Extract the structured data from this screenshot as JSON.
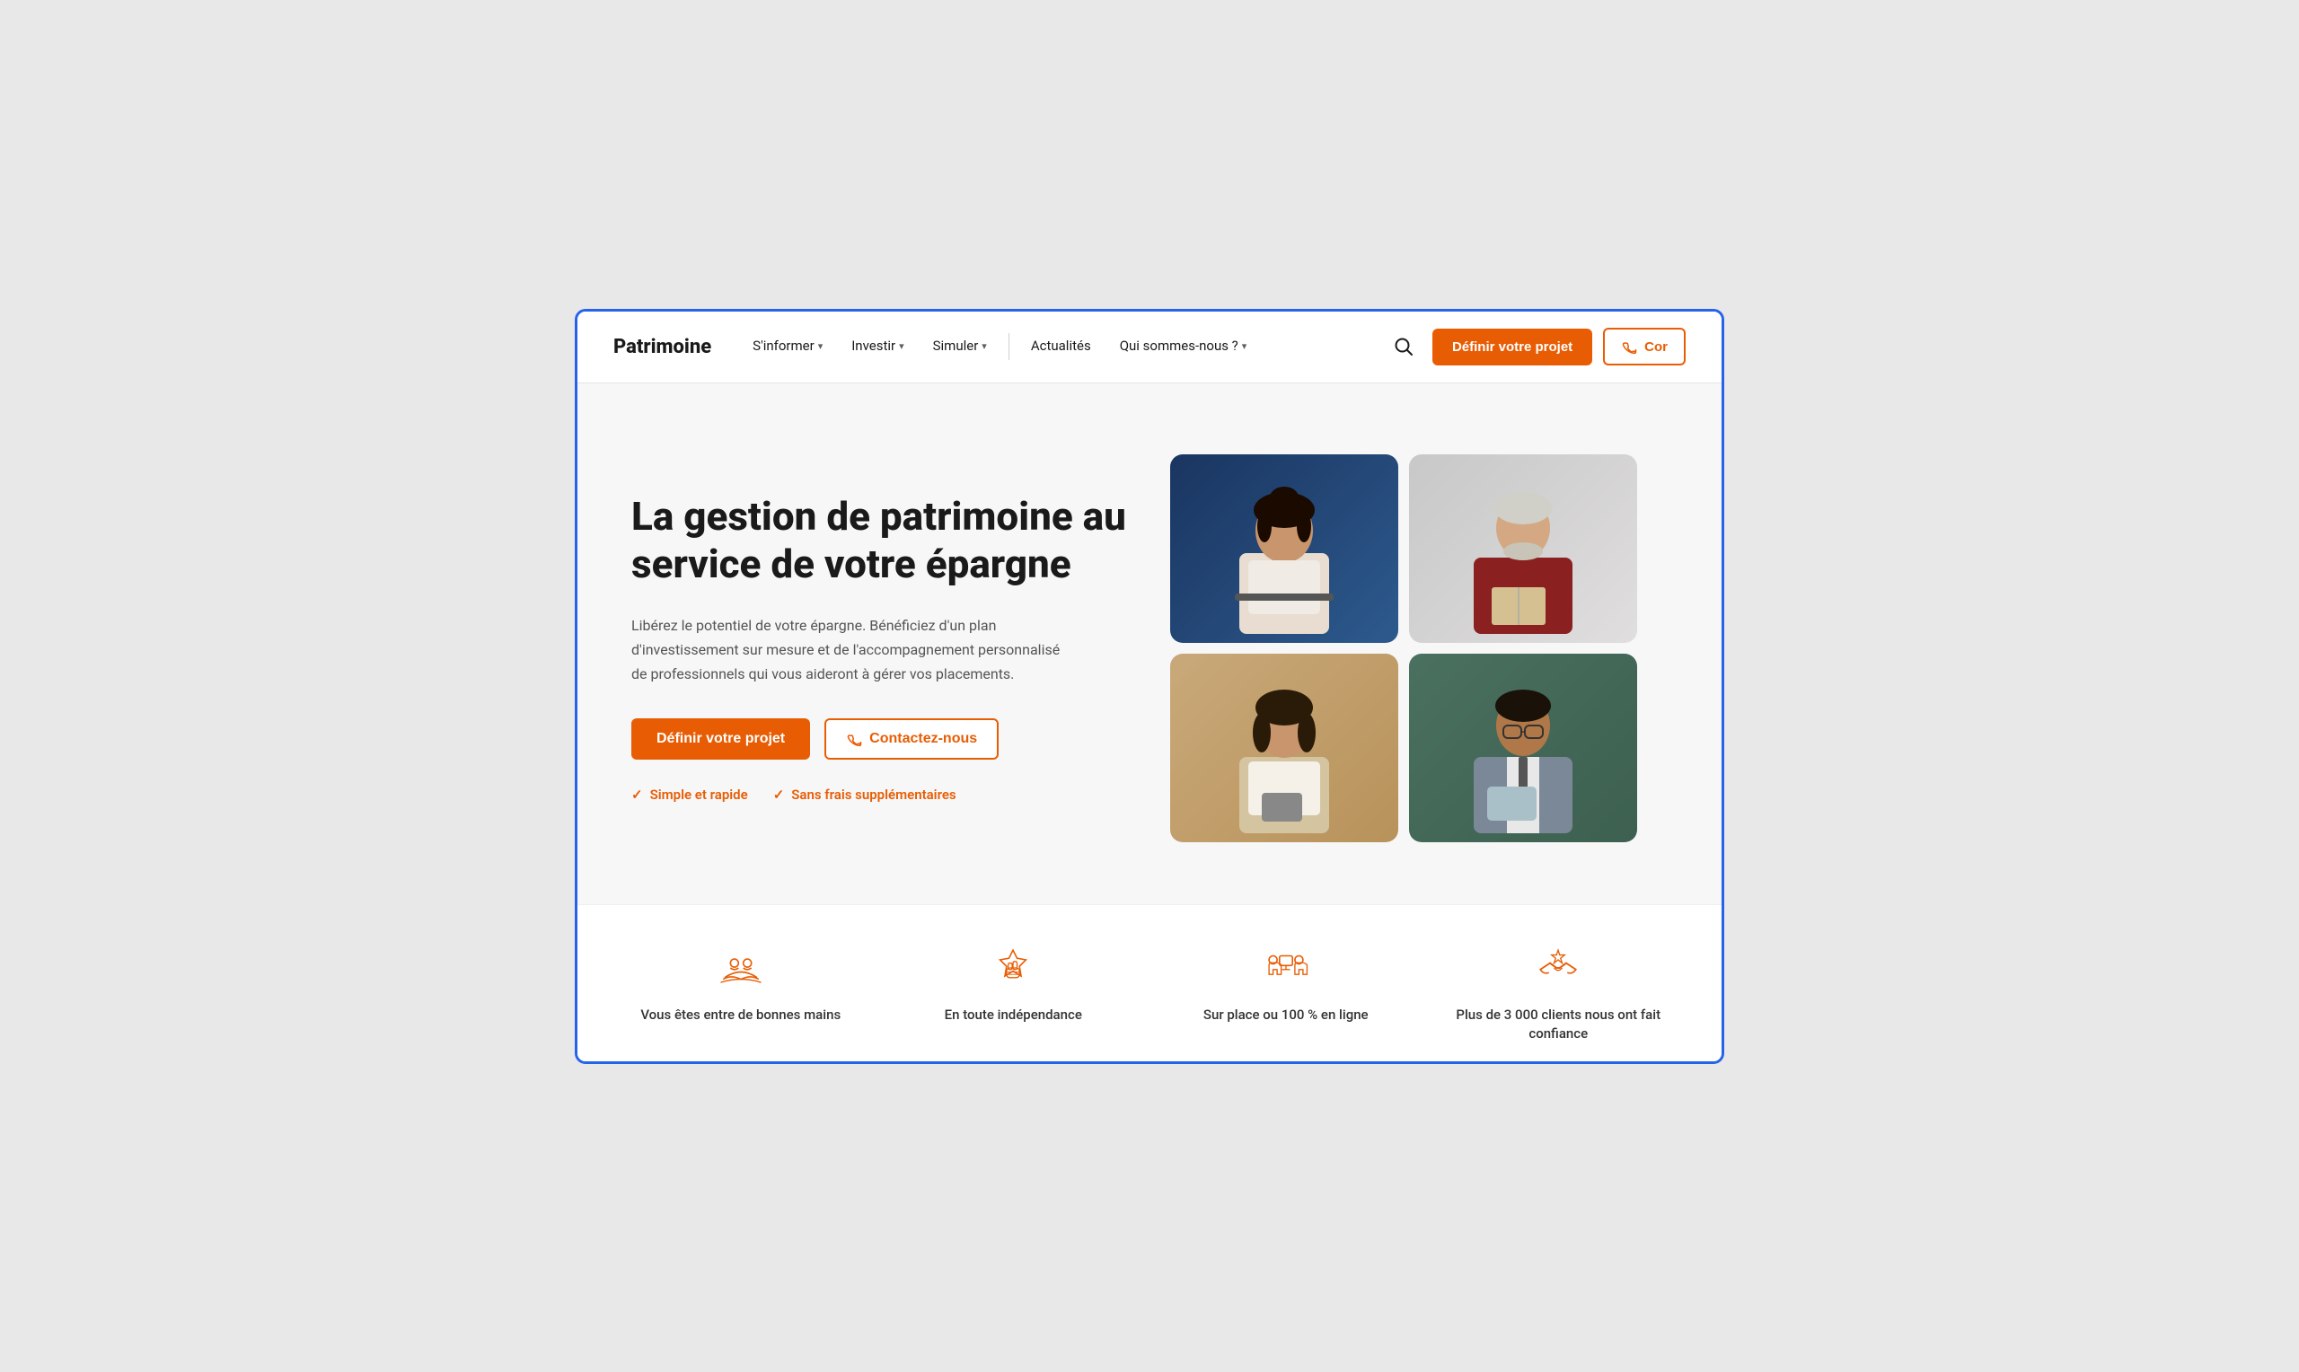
{
  "brand": {
    "logo": "Patrimoine"
  },
  "nav": {
    "items": [
      {
        "label": "S'informer",
        "has_dropdown": true
      },
      {
        "label": "Investir",
        "has_dropdown": true
      },
      {
        "label": "Simuler",
        "has_dropdown": true
      },
      {
        "label": "Actualités",
        "has_dropdown": false
      },
      {
        "label": "Qui sommes-nous ?",
        "has_dropdown": true
      }
    ],
    "cta_primary": "Définir votre projet",
    "cta_contact": "Cor"
  },
  "hero": {
    "title": "La gestion de patrimoine au service de votre épargne",
    "description": "Libérez le potentiel de votre épargne. Bénéficiez d'un plan d'investissement sur mesure et de l'accompagnement personnalisé de professionnels qui vous aideront à gérer vos placements.",
    "btn_primary": "Définir votre projet",
    "btn_contact": "Contactez-nous",
    "check1": "Simple et rapide",
    "check2": "Sans frais supplémentaires"
  },
  "stats": [
    {
      "icon": "hands-care-icon",
      "label": "Vous êtes entre de bonnes mains"
    },
    {
      "icon": "independence-icon",
      "label": "En toute indépendance"
    },
    {
      "icon": "online-icon",
      "label": "Sur place ou 100 % en ligne"
    },
    {
      "icon": "clients-icon",
      "label": "Plus de 3 000 clients nous ont fait confiance"
    }
  ],
  "colors": {
    "orange": "#e85d04",
    "dark": "#1a1a1a",
    "light_bg": "#f7f7f8"
  }
}
